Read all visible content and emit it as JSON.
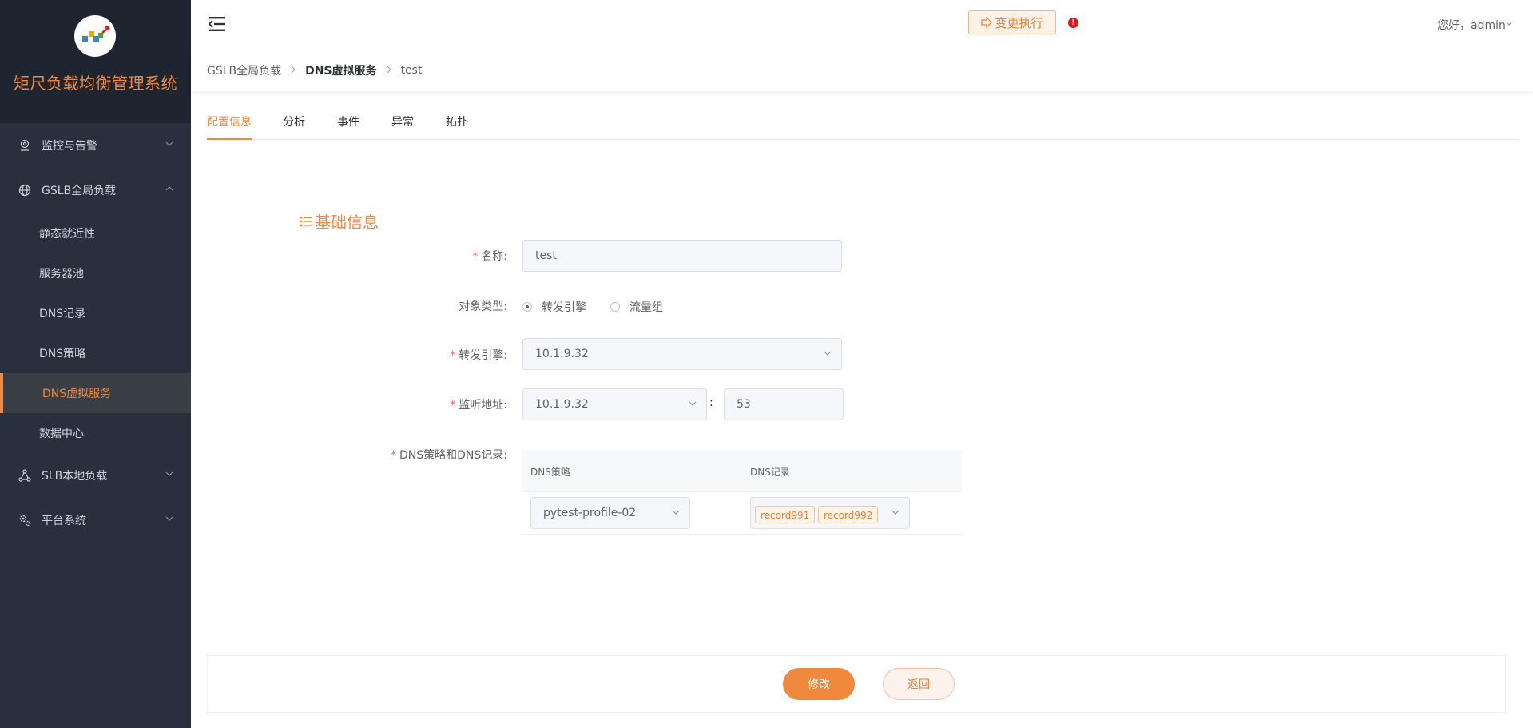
{
  "app": {
    "title": "矩尺负载均衡管理系统"
  },
  "colors": {
    "accent": "#f0883e",
    "sidebar_bg": "#28303e",
    "brand_bg": "#1e2530",
    "alert": "#e8141c"
  },
  "sidebar": {
    "groups": [
      {
        "label": "监控与告警",
        "icon": "location-pin-icon",
        "expanded": false
      },
      {
        "label": "GSLB全局负载",
        "icon": "globe-icon",
        "expanded": true
      },
      {
        "label": "SLB本地负载",
        "icon": "network-nodes-icon",
        "expanded": false
      },
      {
        "label": "平台系统",
        "icon": "settings-gear-icon",
        "expanded": false
      }
    ],
    "gslb_items": [
      {
        "label": "静态就近性"
      },
      {
        "label": "服务器池"
      },
      {
        "label": "DNS记录"
      },
      {
        "label": "DNS策略"
      },
      {
        "label": "DNS虚拟服务",
        "active": true
      },
      {
        "label": "数据中心"
      }
    ]
  },
  "header": {
    "exec_button": "变更执行",
    "alert_mark": "!",
    "greeting": "您好，admin"
  },
  "breadcrumb": [
    "GSLB全局负载",
    "DNS虚拟服务",
    "test"
  ],
  "tabs": [
    {
      "label": "配置信息",
      "active": true
    },
    {
      "label": "分析"
    },
    {
      "label": "事件"
    },
    {
      "label": "异常"
    },
    {
      "label": "拓扑"
    }
  ],
  "form": {
    "section_title": "基础信息",
    "name": {
      "label": "名称:",
      "value": "test"
    },
    "object_type": {
      "label": "对象类型:",
      "options": [
        "转发引擎",
        "流量组"
      ],
      "selected": "转发引擎"
    },
    "engine": {
      "label": "转发引擎:",
      "value": "10.1.9.32"
    },
    "listen": {
      "label": "监听地址:",
      "ip": "10.1.9.32",
      "separator": ":",
      "port": "53"
    },
    "dns": {
      "label": "DNS策略和DNS记录:",
      "columns": [
        "DNS策略",
        "DNS记录"
      ],
      "rows": [
        {
          "policy": "pytest-profile-02",
          "records": [
            "record991",
            "record992"
          ]
        }
      ]
    }
  },
  "footer": {
    "modify": "修改",
    "back": "返回"
  }
}
